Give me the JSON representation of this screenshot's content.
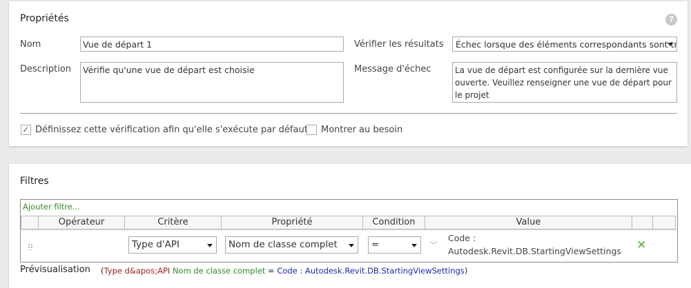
{
  "properties": {
    "title": "Propriétés",
    "help_icon": "?",
    "name_label": "Nom",
    "name_value": "Vue de départ 1",
    "description_label": "Description",
    "description_value": "Vérifie qu'une vue de départ est choisie",
    "verify_label": "Vérifier les résultats",
    "verify_value": "Échec lorsque des éléments correspondants sont trou",
    "failure_label": "Message d'échec",
    "failure_value": "La vue de départ est configurée sur la dernière vue ouverte. Veuillez renseigner une vue de départ pour le projet",
    "default_check_label": "Définissez cette vérification afin qu'elle s'exécute par défaut",
    "default_check_mark": "✓",
    "show_check_label": "Montrer au besoin"
  },
  "filters": {
    "title": "Filtres",
    "add_filter": "Ajouter filtre...",
    "columns": [
      "Opérateur",
      "Critère",
      "Propriété",
      "Condition",
      "Value"
    ],
    "row": {
      "criteria": "Type d'API",
      "property": "Nom de classe complet",
      "condition": "=",
      "value_line1": "Code :",
      "value_line2": "Autodesk.Revit.DB.StartingViewSettings",
      "remove_icon": "✕",
      "chevron": "﹀"
    },
    "preview_label": "Prévisualisation",
    "preview": {
      "open": "(",
      "type": "Type d&apos;API",
      "property": "Nom de classe complet",
      "operator": "=",
      "value": "Code : Autodesk.Revit.DB.StartingViewSettings",
      "close": ")"
    }
  },
  "colors": {
    "accent_green": "#5aaa3a",
    "preview_type": "#a02020",
    "preview_value": "#1a2ab0"
  }
}
